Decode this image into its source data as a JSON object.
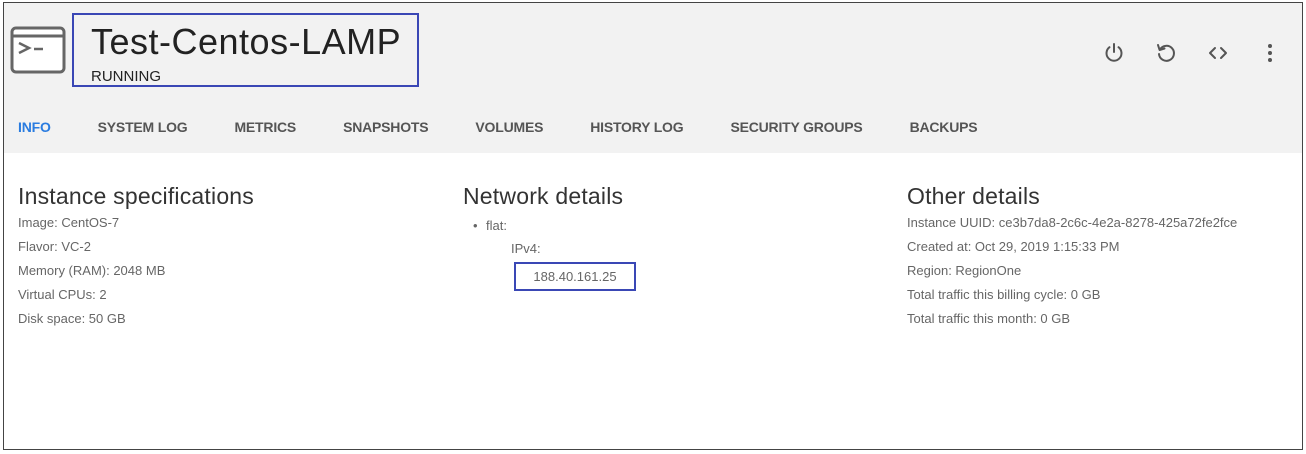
{
  "instance": {
    "name": "Test-Centos-LAMP",
    "status": "RUNNING"
  },
  "icons": {
    "app": "terminal-window-icon",
    "power": "power-icon",
    "refresh": "refresh-icon",
    "console": "code-icon",
    "more": "more-vertical-icon"
  },
  "tabs": [
    {
      "label": "INFO",
      "active": true
    },
    {
      "label": "SYSTEM LOG"
    },
    {
      "label": "METRICS"
    },
    {
      "label": "SNAPSHOTS"
    },
    {
      "label": "VOLUMES"
    },
    {
      "label": "HISTORY LOG"
    },
    {
      "label": "SECURITY GROUPS"
    },
    {
      "label": "BACKUPS"
    }
  ],
  "specs": {
    "heading": "Instance specifications",
    "rows": [
      "Image: CentOS-7",
      "Flavor: VC-2",
      "Memory (RAM): 2048 MB",
      "Virtual CPUs: 2",
      "Disk space: 50 GB"
    ]
  },
  "network": {
    "heading": "Network details",
    "bullet": "•",
    "name": "flat:",
    "family": "IPv4:",
    "address": "188.40.161.25"
  },
  "other": {
    "heading": "Other details",
    "rows": [
      "Instance UUID: ce3b7da8-2c6c-4e2a-8278-425a72fe2fce",
      "Created at: Oct 29, 2019 1:15:33 PM",
      "Region: RegionOne",
      "Total traffic this billing cycle: 0 GB",
      "Total traffic this month: 0 GB"
    ]
  },
  "colors": {
    "accent": "#2a7ce0",
    "highlight_border": "#3a47b5",
    "header_bg": "#f2f2f2"
  }
}
